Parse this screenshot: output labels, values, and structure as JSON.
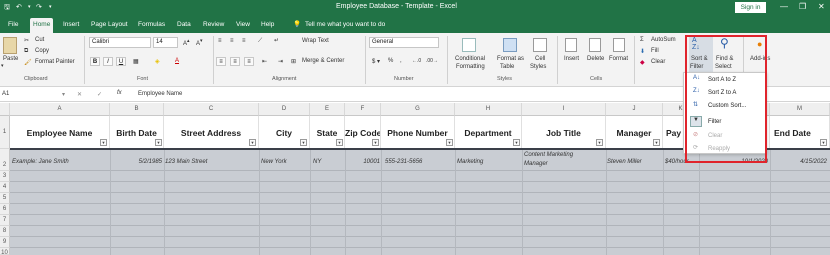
{
  "titlebar": {
    "title": "Employee Database - Template  -  Excel",
    "sign_in": "Sign in",
    "minimize": "—",
    "restore": "❐",
    "close": "✕"
  },
  "tabs": [
    "File",
    "Home",
    "Insert",
    "Page Layout",
    "Formulas",
    "Data",
    "Review",
    "View",
    "Help"
  ],
  "tell_me": "Tell me what you want to do",
  "ribbon": {
    "clipboard": {
      "paste": "Paste",
      "cut": "Cut",
      "copy": "Copy",
      "format_painter": "Format Painter",
      "label": "Clipboard"
    },
    "font": {
      "name": "Calibri",
      "size": "14",
      "bold": "B",
      "italic": "I",
      "underline": "U",
      "label": "Font"
    },
    "alignment": {
      "wrap_text": "Wrap Text",
      "merge": "Merge & Center",
      "label": "Alignment"
    },
    "number": {
      "format": "General",
      "label": "Number"
    },
    "styles": {
      "conditional_1": "Conditional",
      "conditional_2": "Formatting",
      "format_table_1": "Format as",
      "format_table_2": "Table",
      "cell_styles_1": "Cell",
      "cell_styles_2": "Styles",
      "label": "Styles"
    },
    "cells": {
      "insert": "Insert",
      "delete": "Delete",
      "format": "Format",
      "label": "Cells"
    },
    "editing": {
      "autosum": "AutoSum",
      "fill": "Fill",
      "clear": "Clear",
      "sort_filter_1": "Sort &",
      "sort_filter_2": "Filter",
      "find_select_1": "Find &",
      "find_select_2": "Select",
      "label": "Ed"
    },
    "addins": {
      "label": "Add-ins"
    }
  },
  "formula_bar": {
    "name_box": "A1",
    "fx": "fx",
    "content": "Employee Name"
  },
  "columns": [
    "A",
    "B",
    "C",
    "D",
    "E",
    "F",
    "G",
    "H",
    "I",
    "J",
    "K",
    "L",
    "M"
  ],
  "rows": [
    "1",
    "2",
    "3",
    "4",
    "5",
    "6",
    "7",
    "8",
    "9",
    "10"
  ],
  "headers": [
    "Employee Name",
    "Birth Date",
    "Street Address",
    "City",
    "State",
    "Zip Code",
    "Phone Number",
    "Department",
    "Job Title",
    "Manager",
    "Pay",
    "",
    "End Date"
  ],
  "example_row": {
    "name": "Example: Jane Smith",
    "birth": "5/2/1985",
    "street": "123 Main Street",
    "city": "New York",
    "state": "NY",
    "zip": "10001",
    "phone": "555-231-5656",
    "dept": "Marketing",
    "job_1": "Content Marketing",
    "job_2": "Manager",
    "manager": "Steven Miller",
    "pay": "$40/hour",
    "start": "10/1/2020",
    "end": "4/15/2022"
  },
  "sort_menu": {
    "items": [
      "Sort A to Z",
      "Sort Z to A",
      "Custom Sort...",
      "Filter",
      "Clear",
      "Reapply"
    ]
  },
  "colors": {
    "excel_green": "#217346",
    "highlight": "#e0242c"
  }
}
